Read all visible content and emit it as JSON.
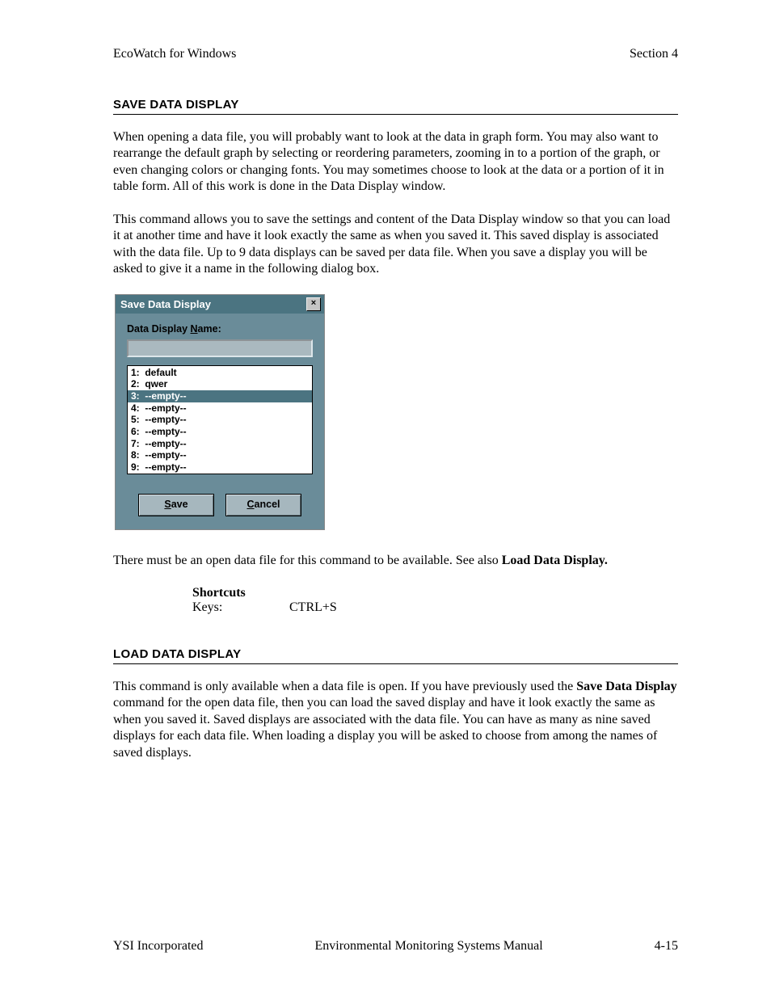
{
  "header": {
    "left": "EcoWatch for Windows",
    "right": "Section 4"
  },
  "section1": {
    "title": "SAVE DATA DISPLAY",
    "p1": "When opening a data file, you will probably want to look at the data in graph form.  You may also want to rearrange the default graph by selecting or reordering parameters, zooming in to a portion of the graph, or even changing colors or changing fonts.  You may sometimes choose to look at the data or a portion of it in table form.  All of this work is done in the Data Display window.",
    "p2": "This command allows you to save the settings and content of the Data Display window so that you can load it at another time and have it look exactly the same as when you saved it.  This saved display is associated with the data file. Up to 9 data displays can be saved per data file.  When you save a display you will be asked to give it a name in the following dialog box.",
    "after_dialog_pre": "There must be an open data file for this command to be available.  See also ",
    "after_dialog_bold": "Load Data Display.",
    "shortcuts_label": "Shortcuts",
    "shortcuts_key_label": "Keys:",
    "shortcuts_key_value": "CTRL+S"
  },
  "dialog": {
    "title": "Save Data Display",
    "close": "×",
    "field_label_pre": "Data Display ",
    "field_label_ul": "N",
    "field_label_post": "ame:",
    "input_value": "",
    "list": [
      {
        "text": "1:  default",
        "selected": false
      },
      {
        "text": "2:  qwer",
        "selected": false
      },
      {
        "text": "3:  --empty--",
        "selected": true
      },
      {
        "text": "4:  --empty--",
        "selected": false
      },
      {
        "text": "5:  --empty--",
        "selected": false
      },
      {
        "text": "6:  --empty--",
        "selected": false
      },
      {
        "text": "7:  --empty--",
        "selected": false
      },
      {
        "text": "8:  --empty--",
        "selected": false
      },
      {
        "text": "9:  --empty--",
        "selected": false
      }
    ],
    "save_ul": "S",
    "save_rest": "ave",
    "cancel_ul": "C",
    "cancel_rest": "ancel"
  },
  "section2": {
    "title": "LOAD DATA DISPLAY",
    "p1_pre": "This command is only available when a data file is open.  If you have previously used the ",
    "p1_bold": "Save Data Display",
    "p1_post": " command for the open data file, then you can load the saved display and have it look exactly the same as when you saved it.  Saved displays are associated with the data file. You can have as many as nine saved displays for each data file.  When loading a display you will be asked to choose from among the names of saved displays."
  },
  "footer": {
    "left": "YSI Incorporated",
    "center": "Environmental Monitoring Systems Manual",
    "right": "4-15"
  }
}
